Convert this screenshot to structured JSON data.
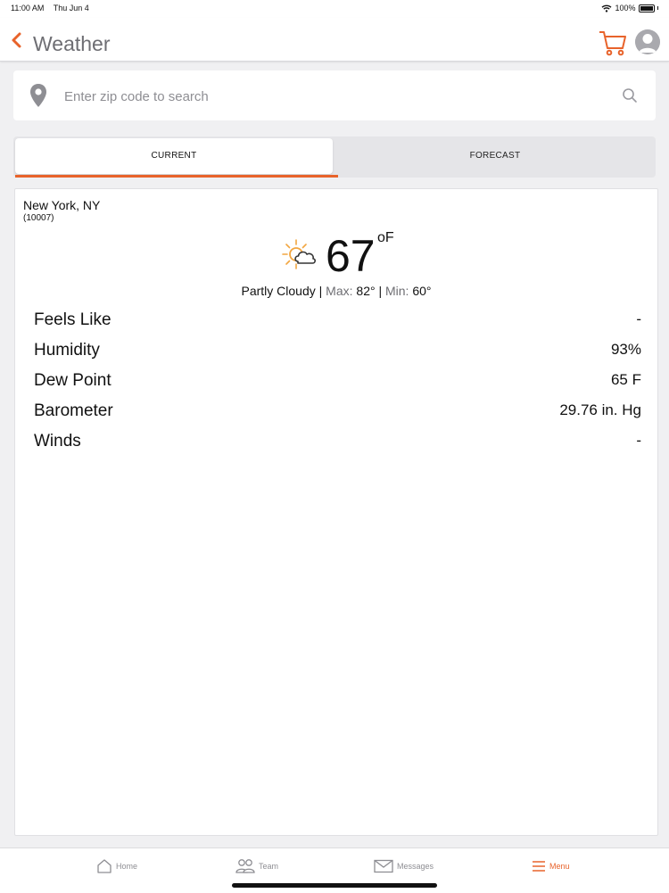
{
  "status_bar": {
    "time": "11:00 AM",
    "date": "Thu Jun 4",
    "battery": "100%"
  },
  "header": {
    "title": "Weather"
  },
  "search": {
    "placeholder": "Enter zip code to search"
  },
  "tabs": [
    {
      "label": "CURRENT",
      "active": true
    },
    {
      "label": "FORECAST",
      "active": false
    }
  ],
  "current": {
    "city": "New York, NY",
    "zip": "(10007)",
    "temperature": "67",
    "unit": "oF",
    "condition": "Partly Cloudy",
    "max_label": "Max:",
    "max_value": "82°",
    "min_label": "Min:",
    "min_value": "60°",
    "icon": "partly-cloudy-icon",
    "details": [
      {
        "label": "Feels Like",
        "value": "-"
      },
      {
        "label": "Humidity",
        "value": "93%"
      },
      {
        "label": "Dew Point",
        "value": "65 F"
      },
      {
        "label": "Barometer",
        "value": "29.76 in. Hg"
      },
      {
        "label": "Winds",
        "value": "-"
      }
    ]
  },
  "bottom_nav": [
    {
      "label": "Home",
      "icon": "home-icon"
    },
    {
      "label": "Team",
      "icon": "team-icon"
    },
    {
      "label": "Messages",
      "icon": "envelope-icon"
    },
    {
      "label": "Menu",
      "icon": "hamburger-icon",
      "active": true
    }
  ],
  "colors": {
    "accent": "#e8632b",
    "background": "#f0f0f2",
    "muted_text": "#8e8e93"
  }
}
